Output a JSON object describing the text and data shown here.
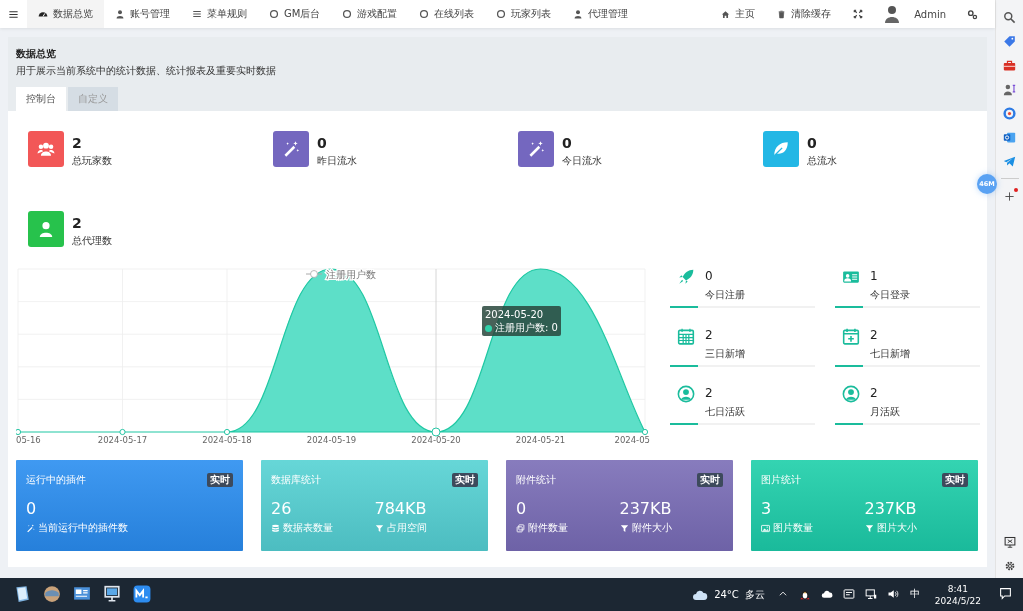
{
  "topbar": {
    "tabs": [
      {
        "label": "数据总览",
        "kind": "dashboard",
        "selected": true
      },
      {
        "label": "账号管理",
        "kind": "user",
        "selected": false
      },
      {
        "label": "菜单规则",
        "kind": "list",
        "selected": false
      },
      {
        "label": "GM后台",
        "kind": "circle",
        "selected": false
      },
      {
        "label": "游戏配置",
        "kind": "circle",
        "selected": false
      },
      {
        "label": "在线列表",
        "kind": "circle",
        "selected": false
      },
      {
        "label": "玩家列表",
        "kind": "circle",
        "selected": false
      },
      {
        "label": "代理管理",
        "kind": "user",
        "selected": false
      }
    ],
    "links": [
      {
        "label": "主页",
        "kind": "home"
      },
      {
        "label": "清除缓存",
        "kind": "trash"
      }
    ],
    "user": "Admin"
  },
  "panel": {
    "title": "数据总览",
    "description": "用于展示当前系统中的统计数据、统计报表及重要实时数据",
    "tabs": [
      {
        "label": "控制台",
        "selected": true
      },
      {
        "label": "自定义",
        "selected": false
      }
    ]
  },
  "stats": [
    {
      "value": "2",
      "label": "总玩家数",
      "kind": "users",
      "color": "#f25757"
    },
    {
      "value": "0",
      "label": "昨日流水",
      "kind": "wand",
      "color": "#7467bf"
    },
    {
      "value": "0",
      "label": "今日流水",
      "kind": "wand",
      "color": "#7467bf"
    },
    {
      "value": "0",
      "label": "总流水",
      "kind": "leaf",
      "color": "#23b7e5"
    },
    {
      "value": "2",
      "label": "总代理数",
      "kind": "user",
      "color": "#27c24c"
    }
  ],
  "chart": {
    "legend": "注册用户数",
    "x_labels": [
      "05-16",
      "2024-05-17",
      "2024-05-18",
      "2024-05-19",
      "2024-05-20",
      "2024-05-21",
      "2024-05"
    ],
    "tooltip": {
      "title": "2024-05-20",
      "text": "注册用户数: 0"
    }
  },
  "mini_stats": [
    {
      "value": "0",
      "label": "今日注册",
      "kind": "rocket"
    },
    {
      "value": "1",
      "label": "今日登录",
      "kind": "idcard"
    },
    {
      "value": "2",
      "label": "三日新增",
      "kind": "calendar"
    },
    {
      "value": "2",
      "label": "七日新增",
      "kind": "calendar-plus"
    },
    {
      "value": "2",
      "label": "七日活跃",
      "kind": "user-circle"
    },
    {
      "value": "2",
      "label": "月活跃",
      "kind": "user-circle"
    }
  ],
  "cards": [
    {
      "title": "运行中的插件",
      "badge": "实时",
      "color": "#2a8ef0",
      "metrics": [
        {
          "value": "0",
          "label": "当前运行中的插件数",
          "kind": "wand"
        }
      ]
    },
    {
      "title": "数据库统计",
      "badge": "实时",
      "color": "#55d2d3",
      "metrics": [
        {
          "value": "26",
          "label": "数据表数量",
          "kind": "database"
        },
        {
          "value": "784KB",
          "label": "占用空间",
          "kind": "filter"
        }
      ]
    },
    {
      "title": "附件统计",
      "badge": "实时",
      "color": "#7a6db6",
      "metrics": [
        {
          "value": "0",
          "label": "附件数量",
          "kind": "copy"
        },
        {
          "value": "237KB",
          "label": "附件大小",
          "kind": "filter"
        }
      ]
    },
    {
      "title": "图片统计",
      "badge": "实时",
      "color": "#1dcfa9",
      "metrics": [
        {
          "value": "3",
          "label": "图片数量",
          "kind": "image"
        },
        {
          "value": "237KB",
          "label": "图片大小",
          "kind": "filter"
        }
      ]
    }
  ],
  "edge_badge": "46M",
  "taskbar": {
    "temperature": "24°C",
    "condition": "多云",
    "ime": "中",
    "time": "8:41",
    "date": "2024/5/22"
  }
}
